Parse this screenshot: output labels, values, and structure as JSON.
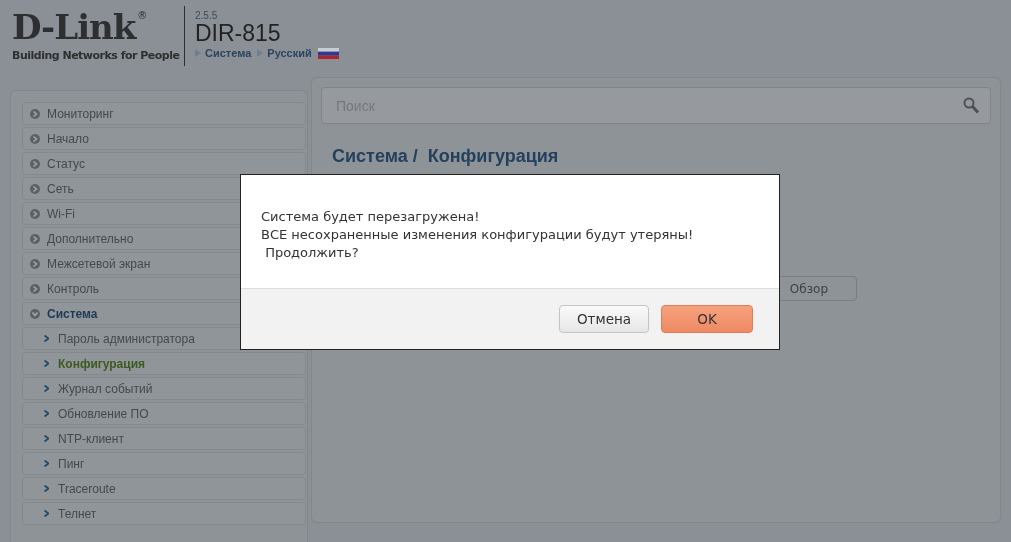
{
  "header": {
    "logo": "D-Link",
    "registered": "®",
    "tagline": "Building Networks for People",
    "version": "2.5.5",
    "model": "DIR-815",
    "breadcrumb": [
      {
        "label": "Система"
      },
      {
        "label": "Русский",
        "flag": true
      }
    ]
  },
  "sidebar": {
    "items": [
      {
        "label": "Мониторинг",
        "selected": false,
        "expanded": false
      },
      {
        "label": "Начало",
        "selected": false,
        "expanded": false
      },
      {
        "label": "Статус",
        "selected": false,
        "expanded": false
      },
      {
        "label": "Сеть",
        "selected": false,
        "expanded": false
      },
      {
        "label": "Wi-Fi",
        "selected": false,
        "expanded": false
      },
      {
        "label": "Дополнительно",
        "selected": false,
        "expanded": false
      },
      {
        "label": "Межсетевой экран",
        "selected": false,
        "expanded": false
      },
      {
        "label": "Контроль",
        "selected": false,
        "expanded": false
      },
      {
        "label": "Система",
        "selected": true,
        "expanded": true,
        "children": [
          {
            "label": "Пароль администратора",
            "selected": false
          },
          {
            "label": "Конфигурация",
            "selected": true
          },
          {
            "label": "Журнал событий",
            "selected": false
          },
          {
            "label": "Обновление ПО",
            "selected": false
          },
          {
            "label": "NTP-клиент",
            "selected": false
          },
          {
            "label": "Пинг",
            "selected": false
          },
          {
            "label": "Traceroute",
            "selected": false
          },
          {
            "label": "Телнет",
            "selected": false
          }
        ]
      }
    ]
  },
  "content": {
    "search": {
      "placeholder": "Поиск"
    },
    "title": "Система /  Конфигурация",
    "browse_button": "Обзор"
  },
  "dialog": {
    "lines": [
      "Система будет перезагружена!",
      "ВСЕ несохраненные изменения конфигурации будут утеряны!",
      " Продолжить?"
    ],
    "buttons": [
      {
        "label": "Отмена",
        "kind": "secondary"
      },
      {
        "label": "OK",
        "kind": "primary"
      }
    ]
  }
}
